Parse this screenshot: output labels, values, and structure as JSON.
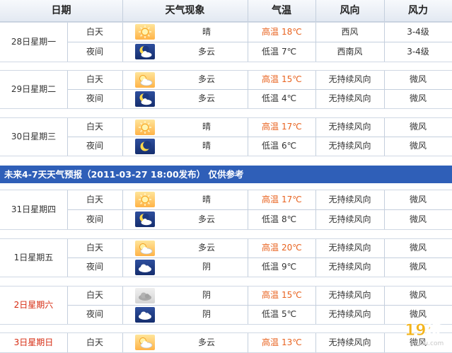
{
  "header": {
    "date": "日期",
    "weather": "天气现象",
    "temp": "气温",
    "wind_dir": "风向",
    "wind_force": "风力"
  },
  "labels": {
    "day": "白天",
    "night": "夜间",
    "high": "高温",
    "low": "低温"
  },
  "banner": "未来4-7天天气预报（2011-03-27 18:00发布）    仅供参考",
  "days": [
    {
      "date": "28日星期一",
      "red": false,
      "day": {
        "icon": "sunny-icon",
        "desc": "晴",
        "temp": "18℃",
        "dir": "西风",
        "force": "3-4级"
      },
      "night": {
        "icon": "moon-cloud-icon",
        "desc": "多云",
        "temp": "7℃",
        "dir": "西南风",
        "force": "3-4级"
      }
    },
    {
      "date": "29日星期二",
      "red": false,
      "day": {
        "icon": "sun-cloud-icon",
        "desc": "多云",
        "temp": "15℃",
        "dir": "无持续风向",
        "force": "微风"
      },
      "night": {
        "icon": "moon-cloud-icon",
        "desc": "多云",
        "temp": "4℃",
        "dir": "无持续风向",
        "force": "微风"
      }
    },
    {
      "date": "30日星期三",
      "red": false,
      "day": {
        "icon": "sunny-icon",
        "desc": "晴",
        "temp": "17℃",
        "dir": "无持续风向",
        "force": "微风"
      },
      "night": {
        "icon": "moon-icon",
        "desc": "晴",
        "temp": "6℃",
        "dir": "无持续风向",
        "force": "微风"
      }
    },
    {
      "date": "31日星期四",
      "red": false,
      "day": {
        "icon": "sunny-icon",
        "desc": "晴",
        "temp": "17℃",
        "dir": "无持续风向",
        "force": "微风"
      },
      "night": {
        "icon": "moon-cloud-icon",
        "desc": "多云",
        "temp": "8℃",
        "dir": "无持续风向",
        "force": "微风"
      }
    },
    {
      "date": "1日星期五",
      "red": false,
      "day": {
        "icon": "sun-cloud-icon",
        "desc": "多云",
        "temp": "20℃",
        "dir": "无持续风向",
        "force": "微风"
      },
      "night": {
        "icon": "cloud-night-icon",
        "desc": "阴",
        "temp": "9℃",
        "dir": "无持续风向",
        "force": "微风"
      }
    },
    {
      "date": "2日星期六",
      "red": true,
      "day": {
        "icon": "overcast-icon",
        "desc": "阴",
        "temp": "15℃",
        "dir": "无持续风向",
        "force": "微风"
      },
      "night": {
        "icon": "cloud-night-icon",
        "desc": "阴",
        "temp": "5℃",
        "dir": "无持续风向",
        "force": "微风"
      }
    },
    {
      "date": "3日星期日",
      "red": true,
      "day": {
        "icon": "sun-cloud-icon",
        "desc": "多云",
        "temp": "13℃",
        "dir": "无持续风向",
        "force": "微风"
      }
    }
  ],
  "watermark": {
    "brand": "19楼",
    "url": "19lou.com"
  },
  "colors": {
    "banner": "#2f5fb8",
    "high": "#e8621e",
    "red_date": "#d62a10",
    "line": "#c4cfdd"
  }
}
